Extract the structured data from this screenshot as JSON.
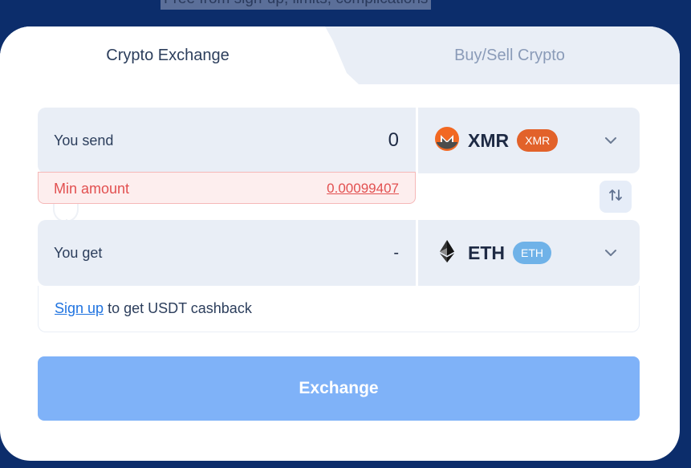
{
  "header": {
    "tagline": "Free from sign-up, limits, complications"
  },
  "tabs": [
    {
      "label": "Crypto Exchange",
      "active": true
    },
    {
      "label": "Buy/Sell Crypto",
      "active": false
    }
  ],
  "send": {
    "label": "You send",
    "amount": "0",
    "coin": {
      "ticker": "XMR",
      "badge": "XMR",
      "icon": "monero-icon",
      "badge_color": "#e2622a"
    },
    "min_label": "Min amount",
    "min_value": "0.00099407"
  },
  "get": {
    "label": "You get",
    "amount": "-",
    "coin": {
      "ticker": "ETH",
      "badge": "ETH",
      "icon": "ethereum-icon",
      "badge_color": "#6fb2e8"
    }
  },
  "cashback": {
    "link": "Sign up",
    "text": " to get USDT cashback"
  },
  "exchange_button": {
    "label": "Exchange"
  },
  "colors": {
    "background": "#0c2d6b",
    "button": "#7fb2f8",
    "error": "#e25050",
    "link": "#1f73e0"
  }
}
